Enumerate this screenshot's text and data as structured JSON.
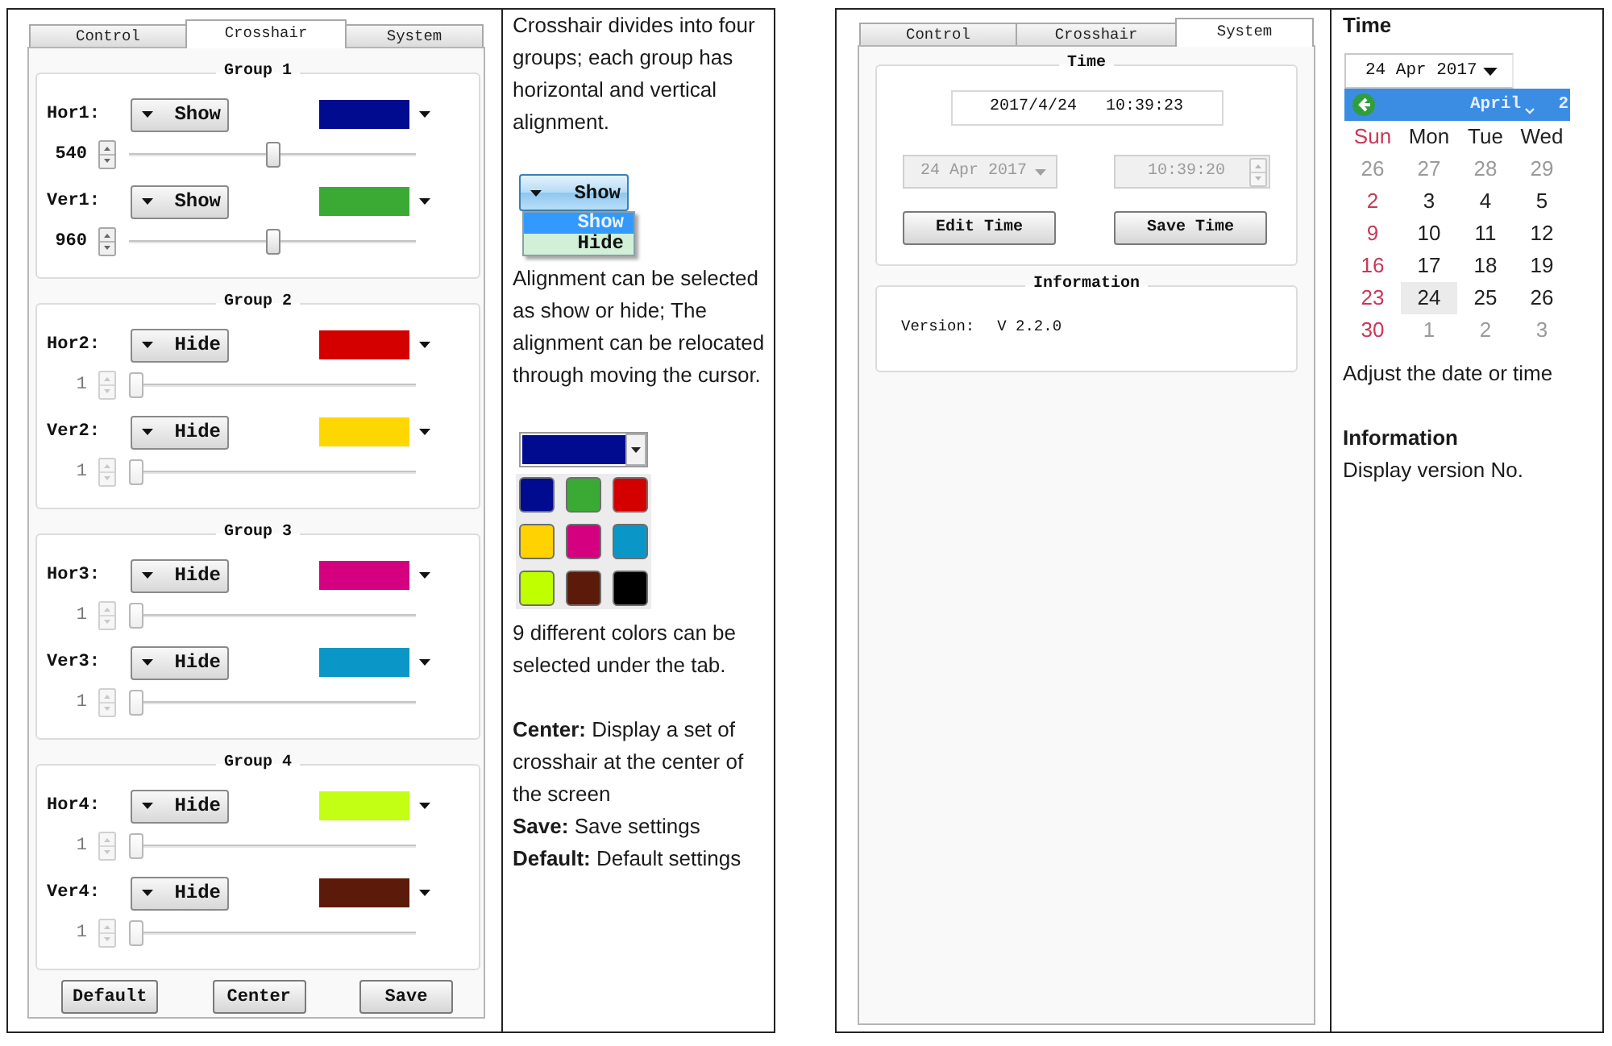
{
  "crosshair_table": {
    "app": {
      "tabs": [
        {
          "label": "Control",
          "selected": false
        },
        {
          "label": "Crosshair",
          "selected": true
        },
        {
          "label": "System",
          "selected": false
        }
      ],
      "groups": [
        {
          "title": "Group 1",
          "lines": [
            {
              "label": "Hor1:",
              "visibility": "Show",
              "color": "#000b8f",
              "value": "540",
              "disabled": false,
              "level": 0.5
            },
            {
              "label": "Ver1:",
              "visibility": "Show",
              "color": "#3aaa35",
              "value": "960",
              "disabled": false,
              "level": 0.5
            }
          ]
        },
        {
          "title": "Group 2",
          "lines": [
            {
              "label": "Hor2:",
              "visibility": "Hide",
              "color": "#d40000",
              "value": "1",
              "disabled": true,
              "level": 0
            },
            {
              "label": "Ver2:",
              "visibility": "Hide",
              "color": "#ffd700",
              "value": "1",
              "disabled": true,
              "level": 0
            }
          ]
        },
        {
          "title": "Group 3",
          "lines": [
            {
              "label": "Hor3:",
              "visibility": "Hide",
              "color": "#d4007f",
              "value": "1",
              "disabled": true,
              "level": 0
            },
            {
              "label": "Ver3:",
              "visibility": "Hide",
              "color": "#0a97c8",
              "value": "1",
              "disabled": true,
              "level": 0
            }
          ]
        },
        {
          "title": "Group 4",
          "lines": [
            {
              "label": "Hor4:",
              "visibility": "Hide",
              "color": "#c2ff14",
              "value": "1",
              "disabled": true,
              "level": 0
            },
            {
              "label": "Ver4:",
              "visibility": "Hide",
              "color": "#5c1a0a",
              "value": "1",
              "disabled": true,
              "level": 0
            }
          ]
        }
      ],
      "buttons": [
        "Default",
        "Center",
        "Save"
      ]
    },
    "notes": [
      {
        "kind": "text",
        "text": "Crosshair divides into four groups; each group has horizontal and vertical alignment."
      },
      {
        "kind": "blank"
      },
      {
        "kind": "visibility_demo",
        "button": "Show",
        "options": [
          {
            "label": "Show",
            "selected": true
          },
          {
            "label": "Hide",
            "selected": false
          }
        ]
      },
      {
        "kind": "text",
        "text": "Alignment can be selected as show or hide; The alignment can be relocated through moving the cursor."
      },
      {
        "kind": "blank"
      },
      {
        "kind": "color_demo",
        "current": {
          "color": "#000b8f"
        },
        "swatches": [
          {
            "color": "#000b8f"
          },
          {
            "color": "#3aaa35"
          },
          {
            "color": "#d40000"
          },
          {
            "color": "#ffd200"
          },
          {
            "color": "#d4007f"
          },
          {
            "color": "#0a97c8"
          },
          {
            "color": "#bfff00"
          },
          {
            "color": "#5c1a0a"
          },
          {
            "color": "#000000"
          }
        ]
      },
      {
        "kind": "text",
        "text": "9 different colors can be selected under the tab."
      },
      {
        "kind": "blank"
      },
      {
        "kind": "text",
        "text": "**Center:** Display a set of crosshair at the center of the screen"
      },
      {
        "kind": "text",
        "text": "**Save:** Save settings"
      },
      {
        "kind": "text",
        "text": "**Default:** Default settings"
      }
    ]
  },
  "system_table": {
    "app": {
      "tabs": [
        {
          "label": "Control",
          "selected": false
        },
        {
          "label": "Crosshair",
          "selected": false
        },
        {
          "label": "System",
          "selected": true
        }
      ],
      "time_group": {
        "title": "Time",
        "clock": "2017/4/24   10:39:23",
        "date_field": "24 Apr 2017",
        "time_field": "10:39:20",
        "fields_disabled": true,
        "buttons": [
          "Edit Time",
          "Save Time"
        ]
      },
      "info_group": {
        "title": "Information",
        "label": "Version:",
        "value": "V 2.2.0"
      }
    },
    "notes": [
      {
        "kind": "heading",
        "text": "Time"
      },
      {
        "kind": "calendar_demo",
        "date_field": "24 Apr 2017",
        "month": "April",
        "year": "2",
        "weekdays": [
          "Sun",
          "Mon",
          "Tue",
          "Wed"
        ],
        "days": [
          {
            "label": "26",
            "muted": true,
            "selected": false
          },
          {
            "label": "27",
            "muted": true,
            "selected": false
          },
          {
            "label": "28",
            "muted": true,
            "selected": false
          },
          {
            "label": "29",
            "muted": true,
            "selected": false
          },
          {
            "label": "2",
            "muted": false,
            "selected": false
          },
          {
            "label": "3",
            "muted": false,
            "selected": false
          },
          {
            "label": "4",
            "muted": false,
            "selected": false
          },
          {
            "label": "5",
            "muted": false,
            "selected": false
          },
          {
            "label": "9",
            "muted": false,
            "selected": false
          },
          {
            "label": "10",
            "muted": false,
            "selected": false
          },
          {
            "label": "11",
            "muted": false,
            "selected": false
          },
          {
            "label": "12",
            "muted": false,
            "selected": false
          },
          {
            "label": "16",
            "muted": false,
            "selected": false
          },
          {
            "label": "17",
            "muted": false,
            "selected": false
          },
          {
            "label": "18",
            "muted": false,
            "selected": false
          },
          {
            "label": "19",
            "muted": false,
            "selected": false
          },
          {
            "label": "23",
            "muted": false,
            "selected": false
          },
          {
            "label": "24",
            "muted": false,
            "selected": true
          },
          {
            "label": "25",
            "muted": false,
            "selected": false
          },
          {
            "label": "26",
            "muted": false,
            "selected": false
          },
          {
            "label": "30",
            "muted": false,
            "selected": false
          },
          {
            "label": "1",
            "muted": true,
            "selected": false
          },
          {
            "label": "2",
            "muted": true,
            "selected": false
          },
          {
            "label": "3",
            "muted": true,
            "selected": false
          }
        ]
      },
      {
        "kind": "text",
        "text": "Adjust the date or time"
      },
      {
        "kind": "blank"
      },
      {
        "kind": "heading",
        "text": "Information"
      },
      {
        "kind": "text",
        "text": "Display version No."
      }
    ]
  }
}
